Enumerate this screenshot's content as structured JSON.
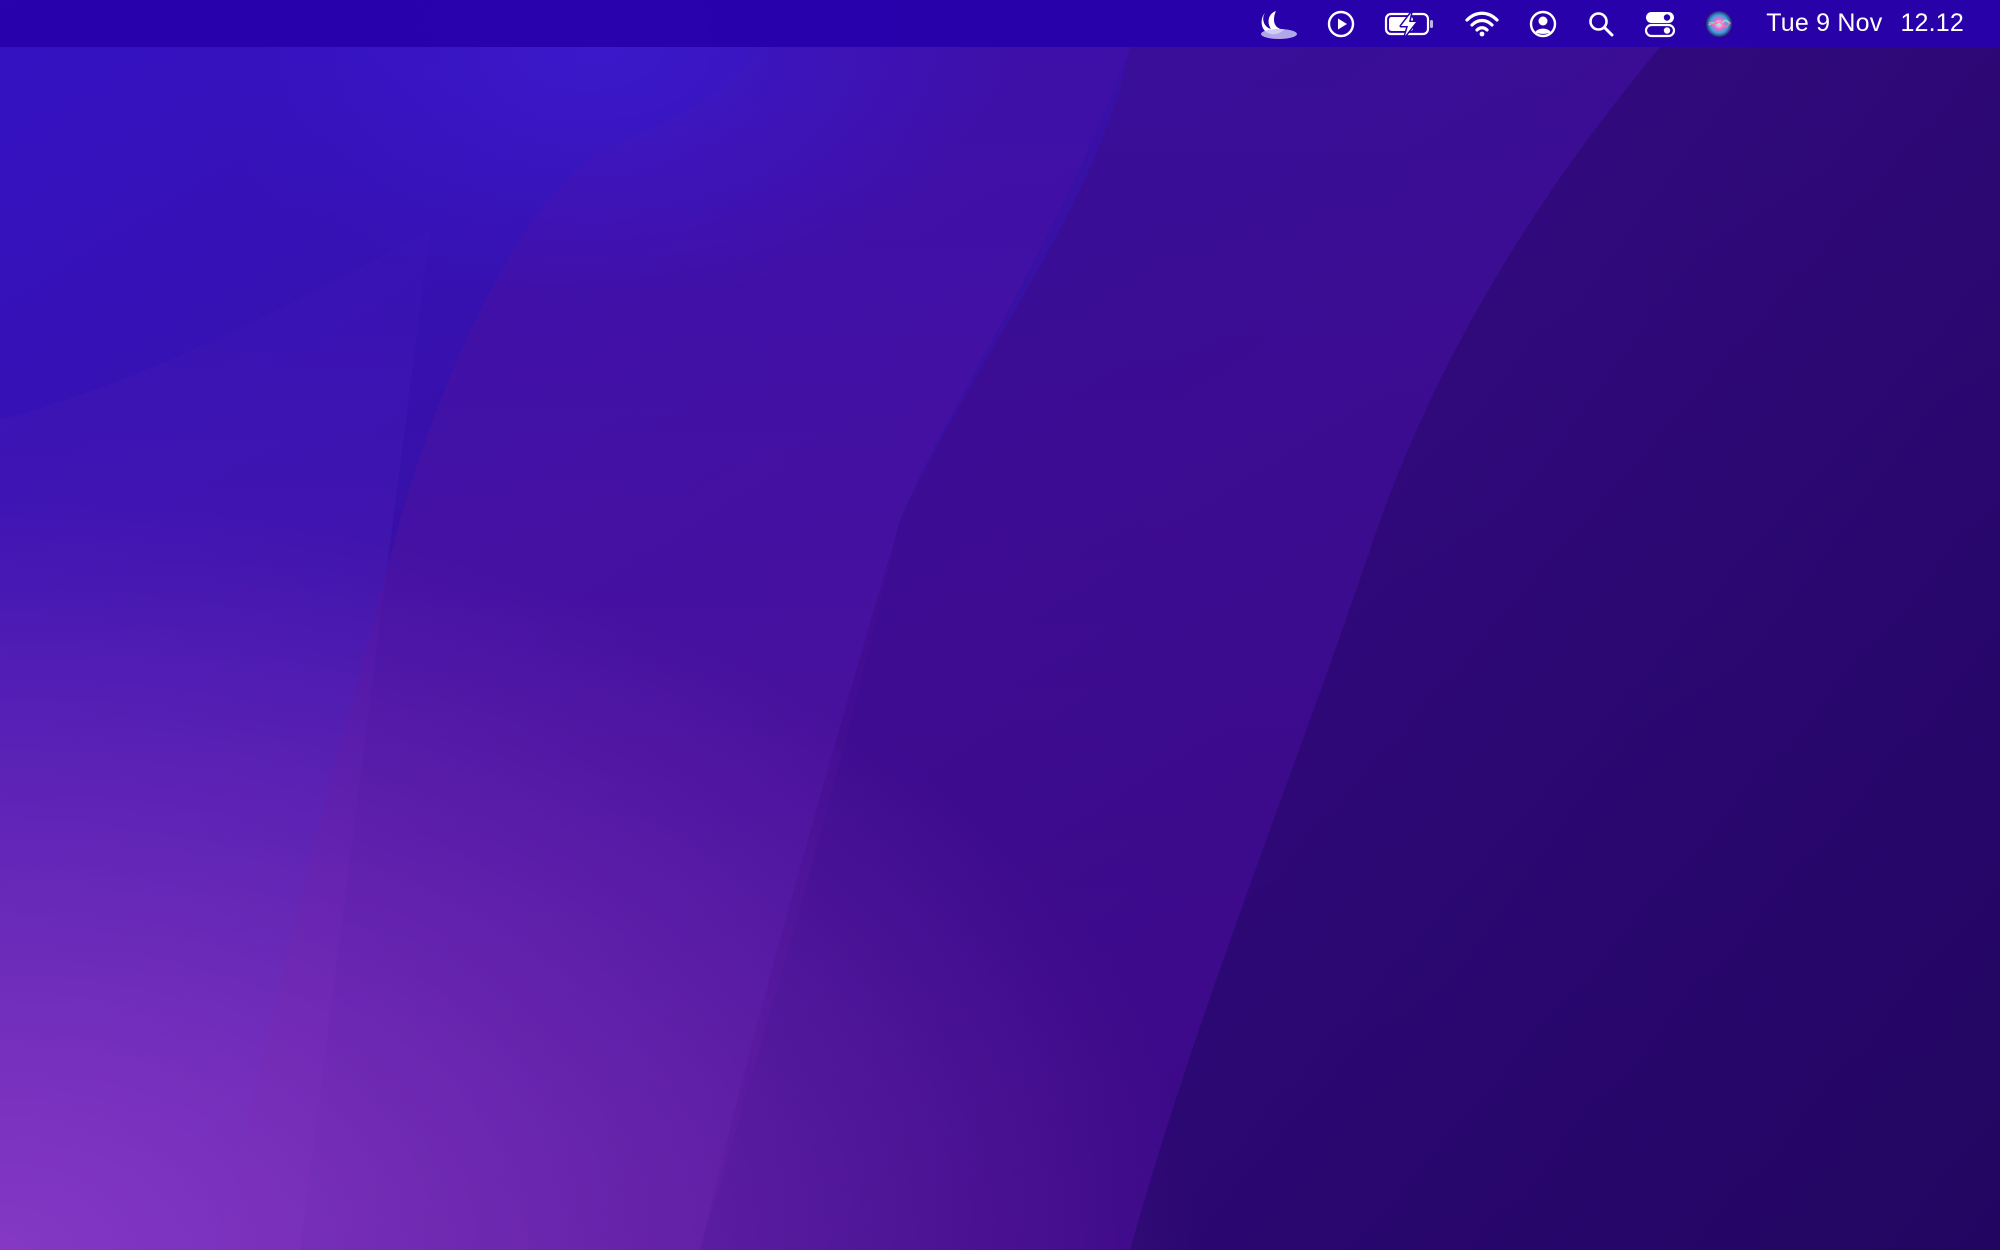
{
  "desktop": {
    "wallpaper_name": "macos-monterey-purple-wave",
    "colors": {
      "base": "#2e0e86",
      "top_left": "#3311c0",
      "bottom_left": "#7a35c0",
      "bottom_right": "#250770",
      "menubar": "#2a00aa"
    }
  },
  "menubar": {
    "status_items": [
      {
        "icon": "weather-night-cloud-icon"
      },
      {
        "icon": "play-circle-icon"
      },
      {
        "icon": "battery-charging-icon"
      },
      {
        "icon": "wifi-icon"
      },
      {
        "icon": "user-circle-icon"
      },
      {
        "icon": "search-icon"
      },
      {
        "icon": "control-center-icon"
      },
      {
        "icon": "siri-icon"
      }
    ],
    "clock": {
      "date": "Tue 9 Nov",
      "time": "12.12"
    }
  }
}
